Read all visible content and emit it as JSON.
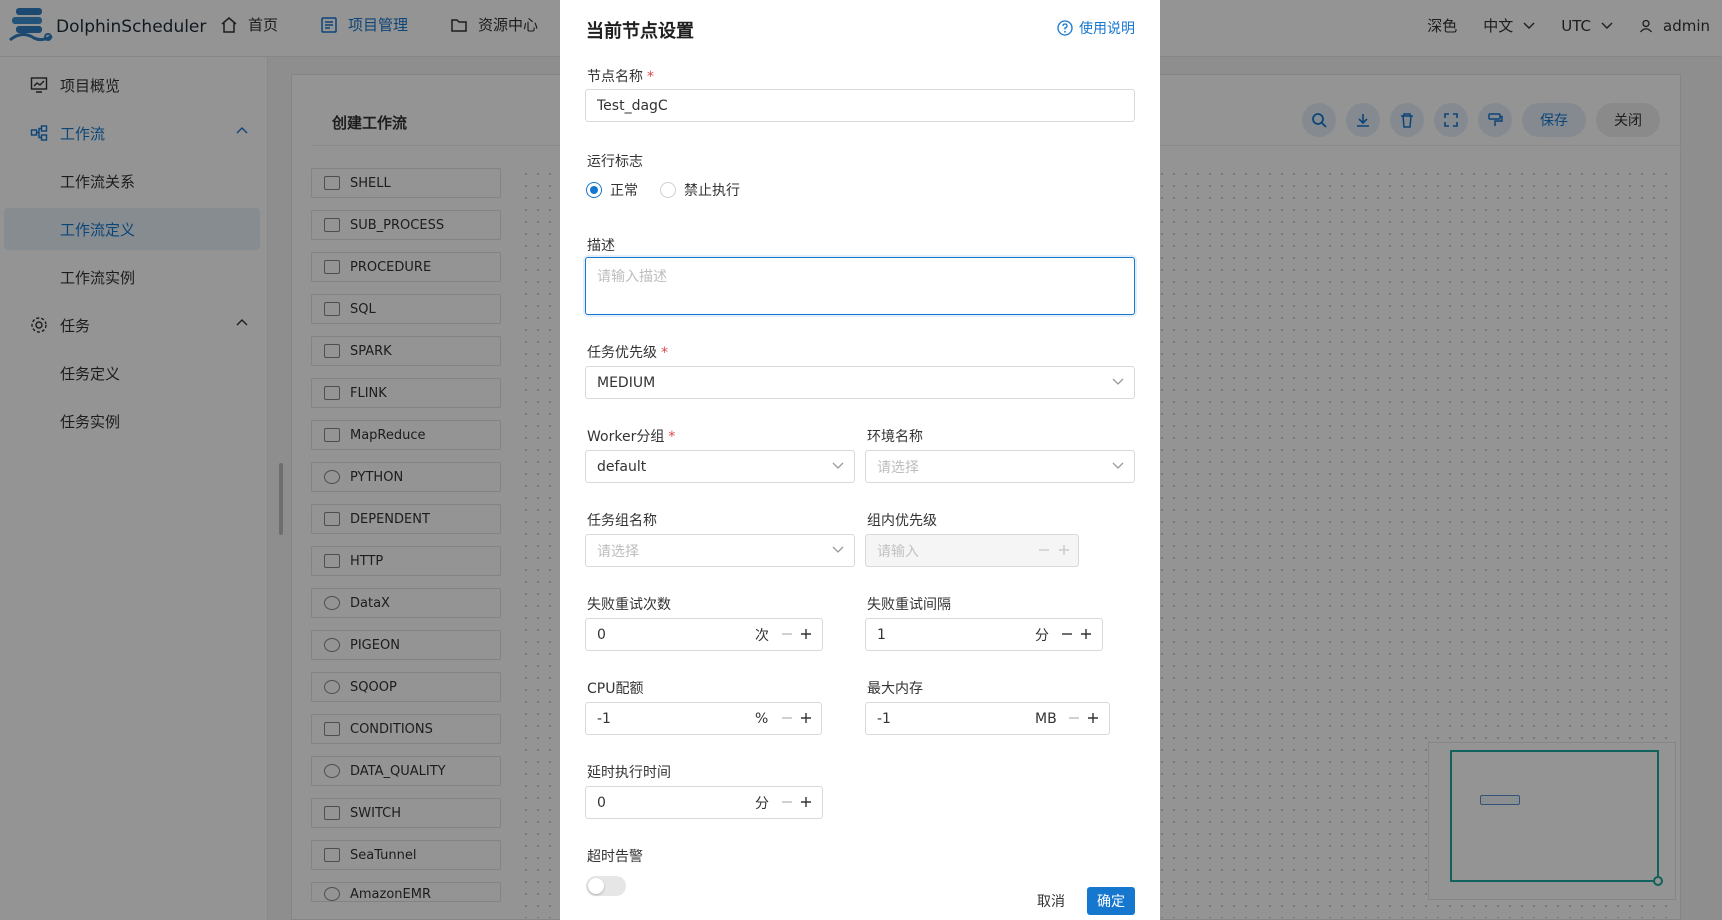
{
  "header": {
    "app_name": "DolphinScheduler",
    "nav": [
      {
        "label": "首页",
        "icon": "home-icon"
      },
      {
        "label": "项目管理",
        "icon": "project-icon"
      },
      {
        "label": "资源中心",
        "icon": "folder-icon"
      }
    ],
    "theme": "深色",
    "language": "中文",
    "timezone": "UTC",
    "user": "admin"
  },
  "sidebar": {
    "items": [
      {
        "label": "项目概览"
      },
      {
        "label": "工作流"
      },
      {
        "label": "工作流关系"
      },
      {
        "label": "工作流定义"
      },
      {
        "label": "工作流实例"
      },
      {
        "label": "任务"
      },
      {
        "label": "任务定义"
      },
      {
        "label": "任务实例"
      }
    ]
  },
  "canvas": {
    "title": "创建工作流",
    "save_label": "保存",
    "close_label": "关闭",
    "palette": [
      "SHELL",
      "SUB_PROCESS",
      "PROCEDURE",
      "SQL",
      "SPARK",
      "FLINK",
      "MapReduce",
      "PYTHON",
      "DEPENDENT",
      "HTTP",
      "DataX",
      "PIGEON",
      "SQOOP",
      "CONDITIONS",
      "DATA_QUALITY",
      "SWITCH",
      "SeaTunnel",
      "AmazonEMR"
    ]
  },
  "drawer": {
    "title": "当前节点设置",
    "help": "使用说明",
    "node_name_label": "节点名称",
    "node_name_value": "Test_dagC",
    "run_flag_label": "运行标志",
    "run_flag_options": [
      "正常",
      "禁止执行"
    ],
    "desc_label": "描述",
    "desc_placeholder": "请输入描述",
    "priority_label": "任务优先级",
    "priority_value": "MEDIUM",
    "worker_label": "Worker分组",
    "worker_value": "default",
    "env_label": "环境名称",
    "env_placeholder": "请选择",
    "taskgroup_label": "任务组名称",
    "taskgroup_placeholder": "请选择",
    "group_priority_label": "组内优先级",
    "group_priority_placeholder": "请输入",
    "retry_times_label": "失败重试次数",
    "retry_times_value": "0",
    "retry_times_unit": "次",
    "retry_interval_label": "失败重试间隔",
    "retry_interval_value": "1",
    "retry_interval_unit": "分",
    "cpu_label": "CPU配额",
    "cpu_value": "-1",
    "cpu_unit": "%",
    "memory_label": "最大内存",
    "memory_value": "-1",
    "memory_unit": "MB",
    "delay_label": "延时执行时间",
    "delay_value": "0",
    "delay_unit": "分",
    "timeout_label": "超时告警",
    "cancel_label": "取消",
    "ok_label": "确定"
  },
  "colors": {
    "accent": "#1677cf",
    "required": "#e04848",
    "minimap": "#1fa8a0"
  }
}
